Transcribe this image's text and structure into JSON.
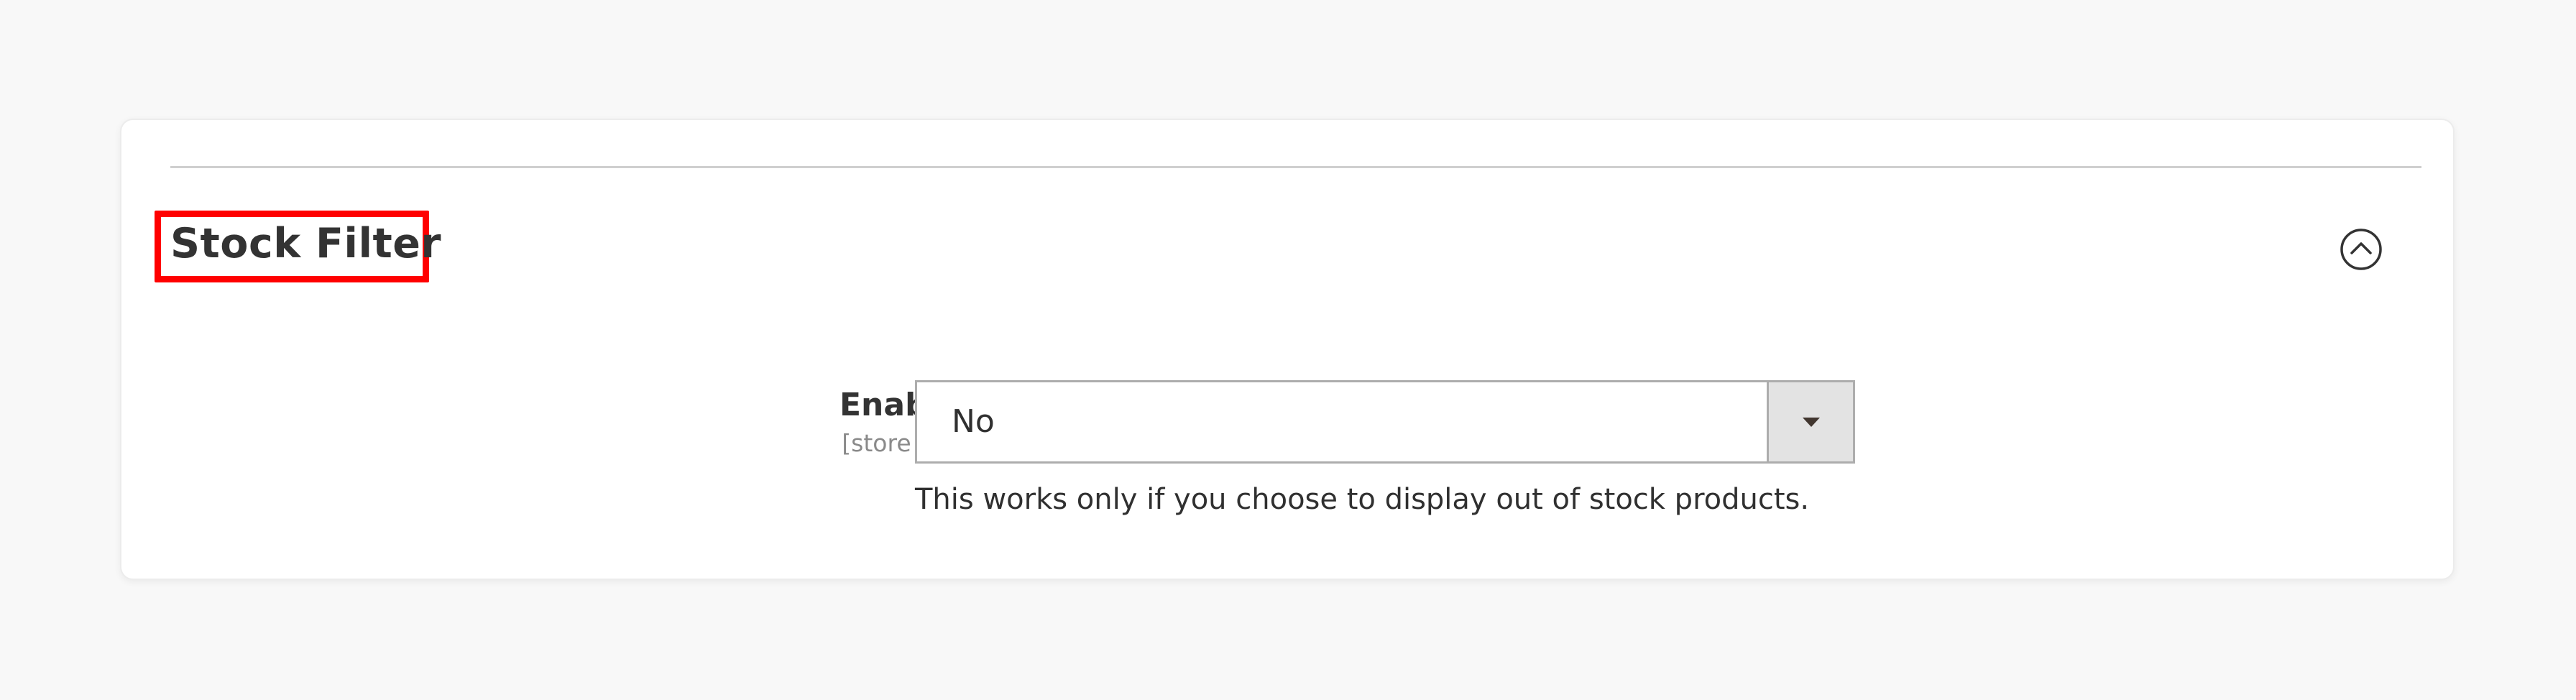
{
  "section": {
    "title": "Stock Filter",
    "toggle_icon": "chevron-up-circle-icon",
    "highlight_color": "#ff0000"
  },
  "field": {
    "label": "Enabled",
    "scope": "[store view]",
    "selected_value": "No",
    "dropdown_icon": "caret-down-icon",
    "note": "This works only if you choose to display out of stock products."
  },
  "colors": {
    "page_background": "#f8f8f8",
    "card_background": "#ffffff",
    "text": "#333333",
    "muted_text": "#8a8a8a",
    "select_border": "#adadad",
    "select_button": "#e3e3e3"
  }
}
